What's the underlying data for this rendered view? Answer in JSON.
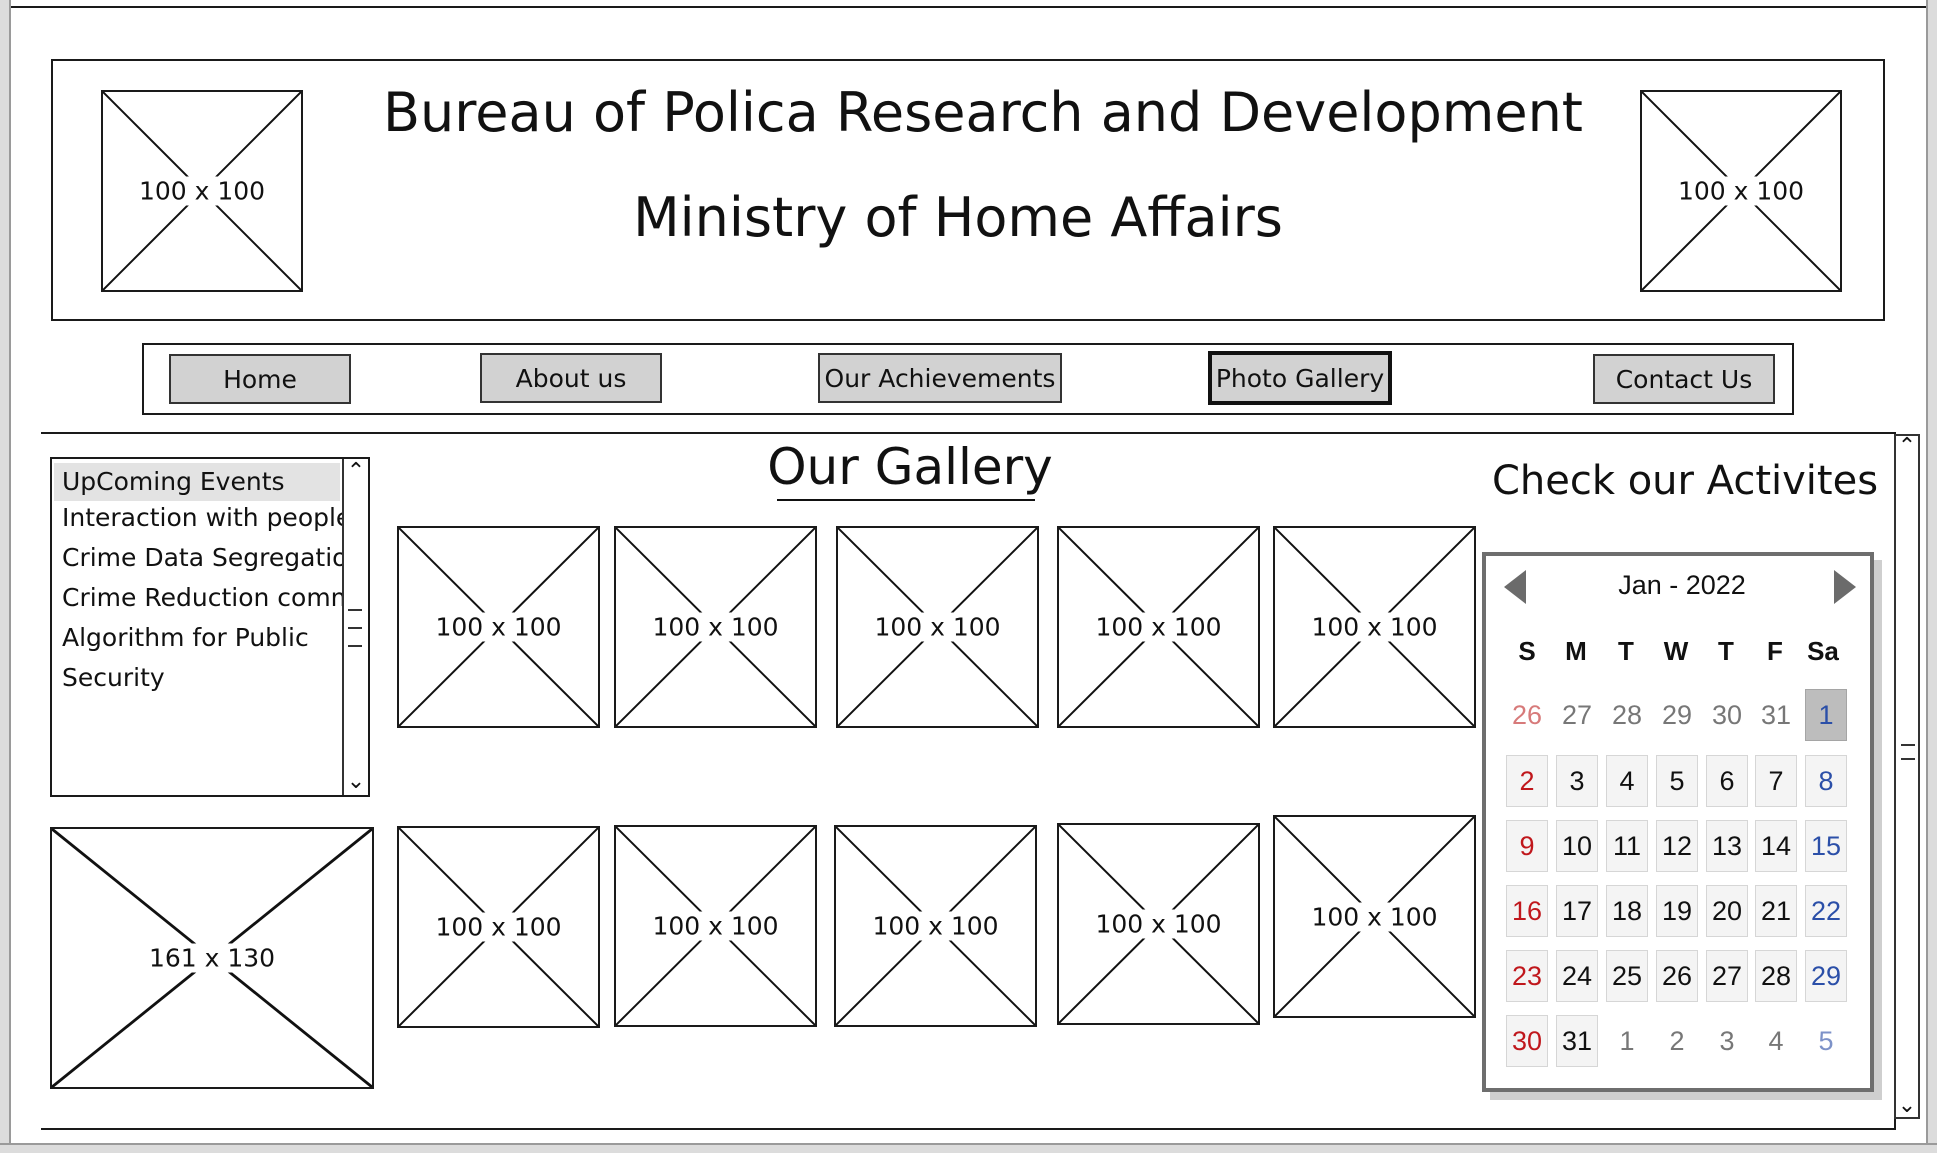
{
  "header": {
    "title": "Bureau of Polica Research and Development",
    "subtitle": "Ministry of Home Affairs",
    "logo_left": "100 x 100",
    "logo_right": "100 x 100"
  },
  "nav": {
    "home": "Home",
    "about": "About us",
    "achievements": "Our Achievements",
    "gallery": "Photo Gallery",
    "contact": "Contact Us"
  },
  "events": {
    "items": [
      "UpComing Events",
      "Interaction with people",
      "Crime Data Segregation",
      "Crime Reduction committ",
      "Algorithm for Public",
      "Security"
    ]
  },
  "sidebar_image": "161 x 130",
  "gallery": {
    "title": "Our Gallery",
    "row1": [
      "100 x 100",
      "100 x 100",
      "100 x 100",
      "100 x 100",
      "100 x 100"
    ],
    "row2": [
      "100 x 100",
      "100 x 100",
      "100 x 100",
      "100 x 100",
      "100 x 100"
    ]
  },
  "activities": {
    "title": "Check our Activites",
    "calendar": {
      "month_label": "Jan - 2022",
      "weekdays": [
        "S",
        "M",
        "T",
        "W",
        "T",
        "F",
        "Sa"
      ],
      "weeks": [
        [
          "26",
          "27",
          "28",
          "29",
          "30",
          "31",
          "1"
        ],
        [
          "2",
          "3",
          "4",
          "5",
          "6",
          "7",
          "8"
        ],
        [
          "9",
          "10",
          "11",
          "12",
          "13",
          "14",
          "15"
        ],
        [
          "16",
          "17",
          "18",
          "19",
          "20",
          "21",
          "22"
        ],
        [
          "23",
          "24",
          "25",
          "26",
          "27",
          "28",
          "29"
        ],
        [
          "30",
          "31",
          "1",
          "2",
          "3",
          "4",
          "5"
        ]
      ],
      "selected": "1",
      "colors": {
        "sunday": "#c0171c",
        "saturday": "#2b4fa8",
        "selected_bg": "#bdbdbd"
      }
    }
  }
}
